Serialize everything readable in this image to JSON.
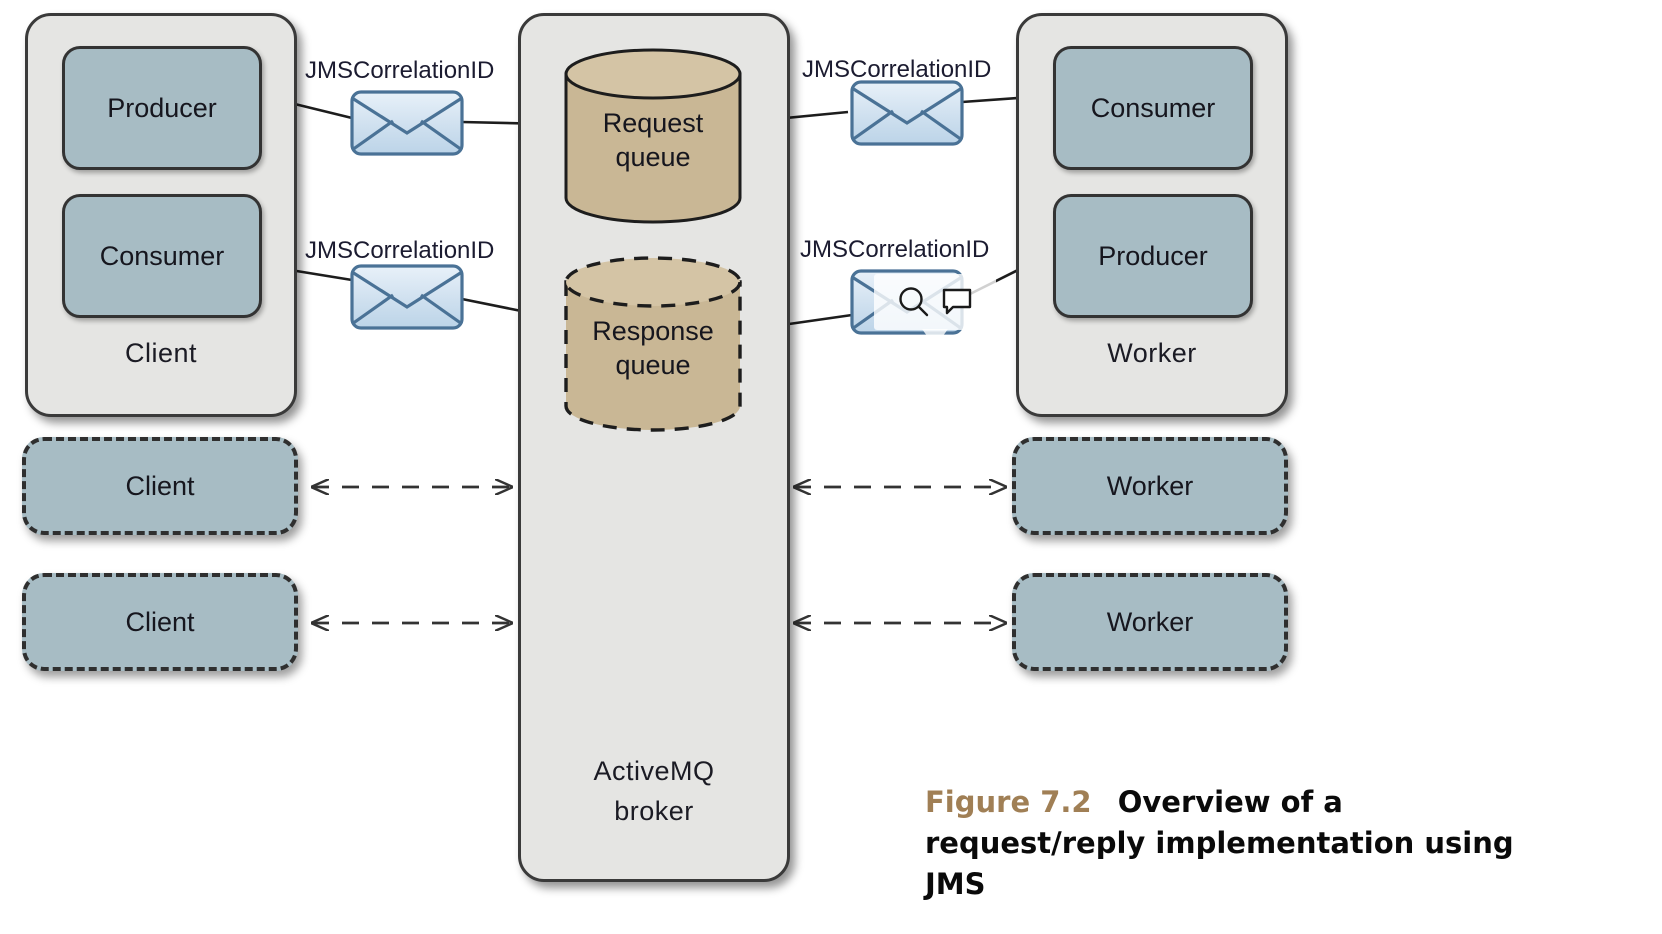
{
  "figure": {
    "number": "Figure 7.2",
    "title": "Overview of a request/reply implementation using JMS"
  },
  "client_panel": {
    "label": "Client",
    "producer": "Producer",
    "consumer": "Consumer"
  },
  "broker_panel": {
    "label_line1": "ActiveMQ",
    "label_line2": "broker",
    "request_queue_line1": "Request",
    "request_queue_line2": "queue",
    "response_queue_line1": "Response",
    "response_queue_line2": "queue"
  },
  "worker_panel": {
    "label": "Worker",
    "consumer": "Consumer",
    "producer": "Producer"
  },
  "replicas": {
    "client_2": "Client",
    "client_3": "Client",
    "worker_2": "Worker",
    "worker_3": "Worker"
  },
  "message_labels": {
    "request_out": "JMSCorrelationID",
    "request_in": "JMSCorrelationID",
    "response_in": "JMSCorrelationID",
    "response_out": "JMSCorrelationID"
  },
  "tooltip": {
    "zoom_icon": "magnifier-icon",
    "comment_icon": "comment-icon"
  },
  "colors": {
    "role_box": "#a7bcc4",
    "panel_bg": "#e5e5e3",
    "queue_fill": "#c9b795",
    "queue_top": "#d4c4a5",
    "envelope_fill": "#cfe0ef",
    "envelope_stroke": "#4a7296",
    "caption_accent": "#a07f55",
    "stroke": "#333333"
  }
}
